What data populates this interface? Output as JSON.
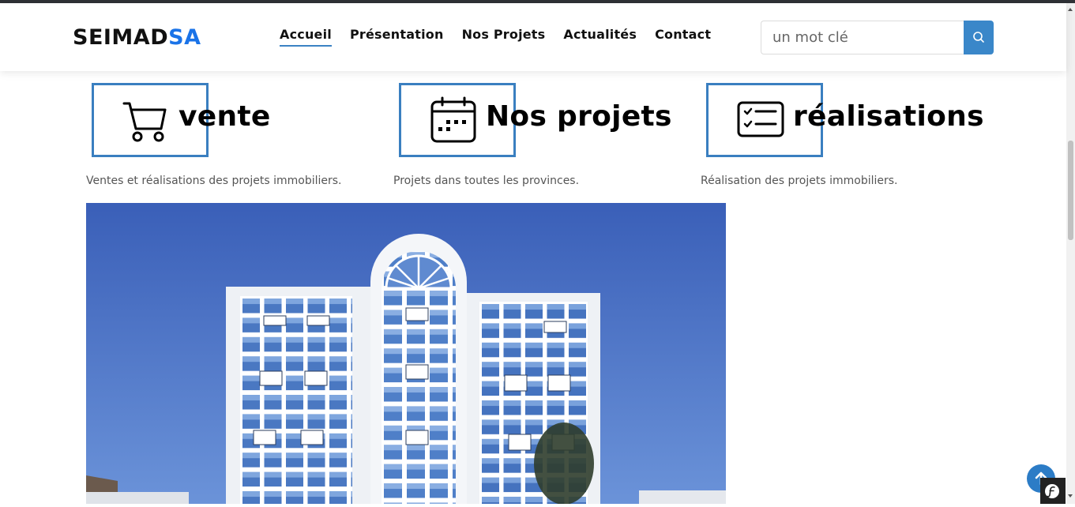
{
  "header": {
    "logo": {
      "main": "SEIMAD",
      "accent": "SA"
    },
    "nav": [
      {
        "label": "Accueil",
        "active": true
      },
      {
        "label": "Présentation",
        "active": false
      },
      {
        "label": "Nos Projets",
        "active": false
      },
      {
        "label": "Actualités",
        "active": false
      },
      {
        "label": "Contact",
        "active": false
      }
    ],
    "search": {
      "placeholder": "un mot clé",
      "icon": "search-icon"
    }
  },
  "features": [
    {
      "icon": "cart-icon",
      "title": "vente",
      "description": "Ventes et réalisations des projets immobiliers."
    },
    {
      "icon": "calendar-icon",
      "title": "Nos projets",
      "description": "Projets dans toutes les provinces."
    },
    {
      "icon": "checklist-icon",
      "title": "réalisations",
      "description": "Réalisation des projets immobiliers."
    }
  ],
  "hero_image": {
    "subject": "building-photo"
  },
  "colors": {
    "accent": "#1a73e8",
    "box_border": "#3a7fc0",
    "search_button": "#3a87c9",
    "back_to_top": "#2c7cc6"
  },
  "widgets": {
    "back_to_top_icon": "arrow-up-icon",
    "debug_badge_icon": "symfony-icon"
  }
}
